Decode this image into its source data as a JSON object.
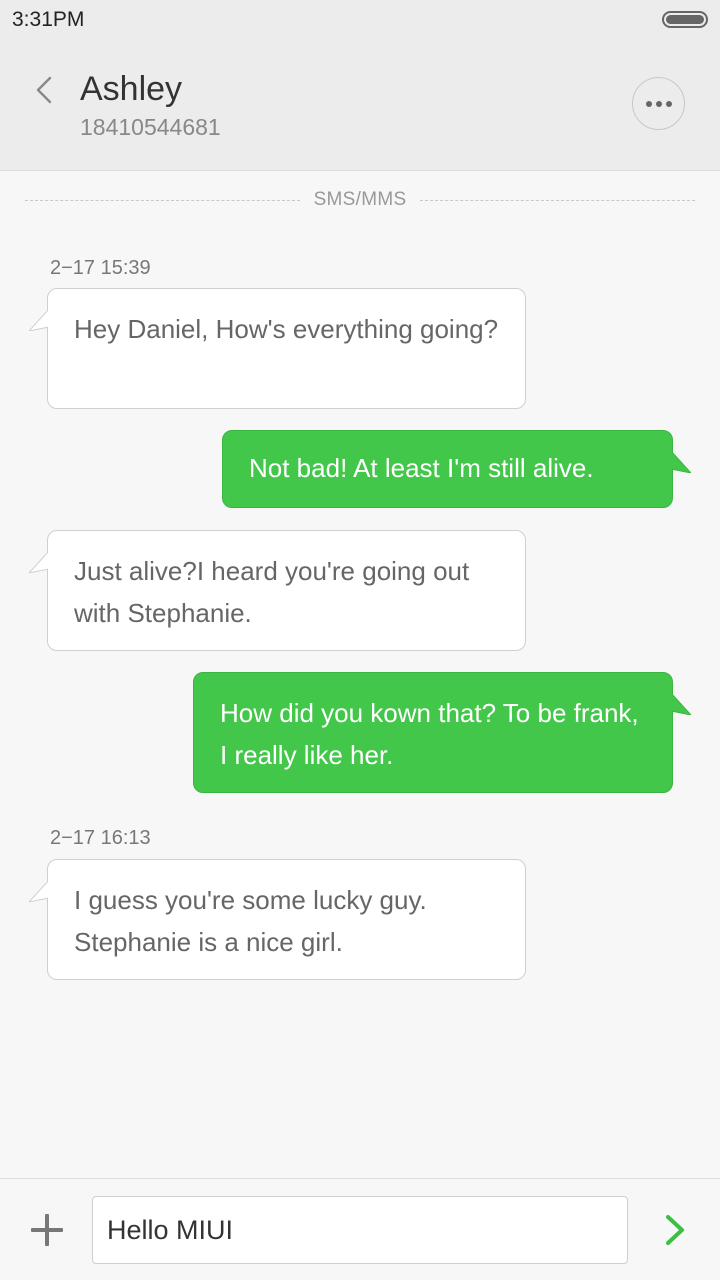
{
  "status_bar": {
    "time": "3:31PM"
  },
  "header": {
    "contact_name": "Ashley",
    "contact_number": "18410544681",
    "back_icon": "chevron-left-icon",
    "more_icon": "more-options-icon"
  },
  "thread": {
    "divider_label": "SMS/MMS",
    "messages": [
      {
        "direction": "incoming",
        "timestamp": "2−17 15:39",
        "text": "Hey Daniel, How's everything going?"
      },
      {
        "direction": "outgoing",
        "text": "Not bad! At least I'm still alive."
      },
      {
        "direction": "incoming",
        "text": "Just  alive?I heard you're going out with Stephanie."
      },
      {
        "direction": "outgoing",
        "text": "How did you kown that? To be frank, I really like her."
      },
      {
        "direction": "incoming",
        "timestamp": "2−17 16:13",
        "text": "I guess you're some lucky guy. Stephanie is a nice girl."
      }
    ]
  },
  "composer": {
    "value": "Hello MIUI",
    "add_icon": "plus-icon",
    "send_icon": "send-chevron-icon"
  },
  "colors": {
    "outgoing_bubble": "#43c74a",
    "incoming_bubble": "#ffffff",
    "send_icon": "#3cbf45"
  }
}
